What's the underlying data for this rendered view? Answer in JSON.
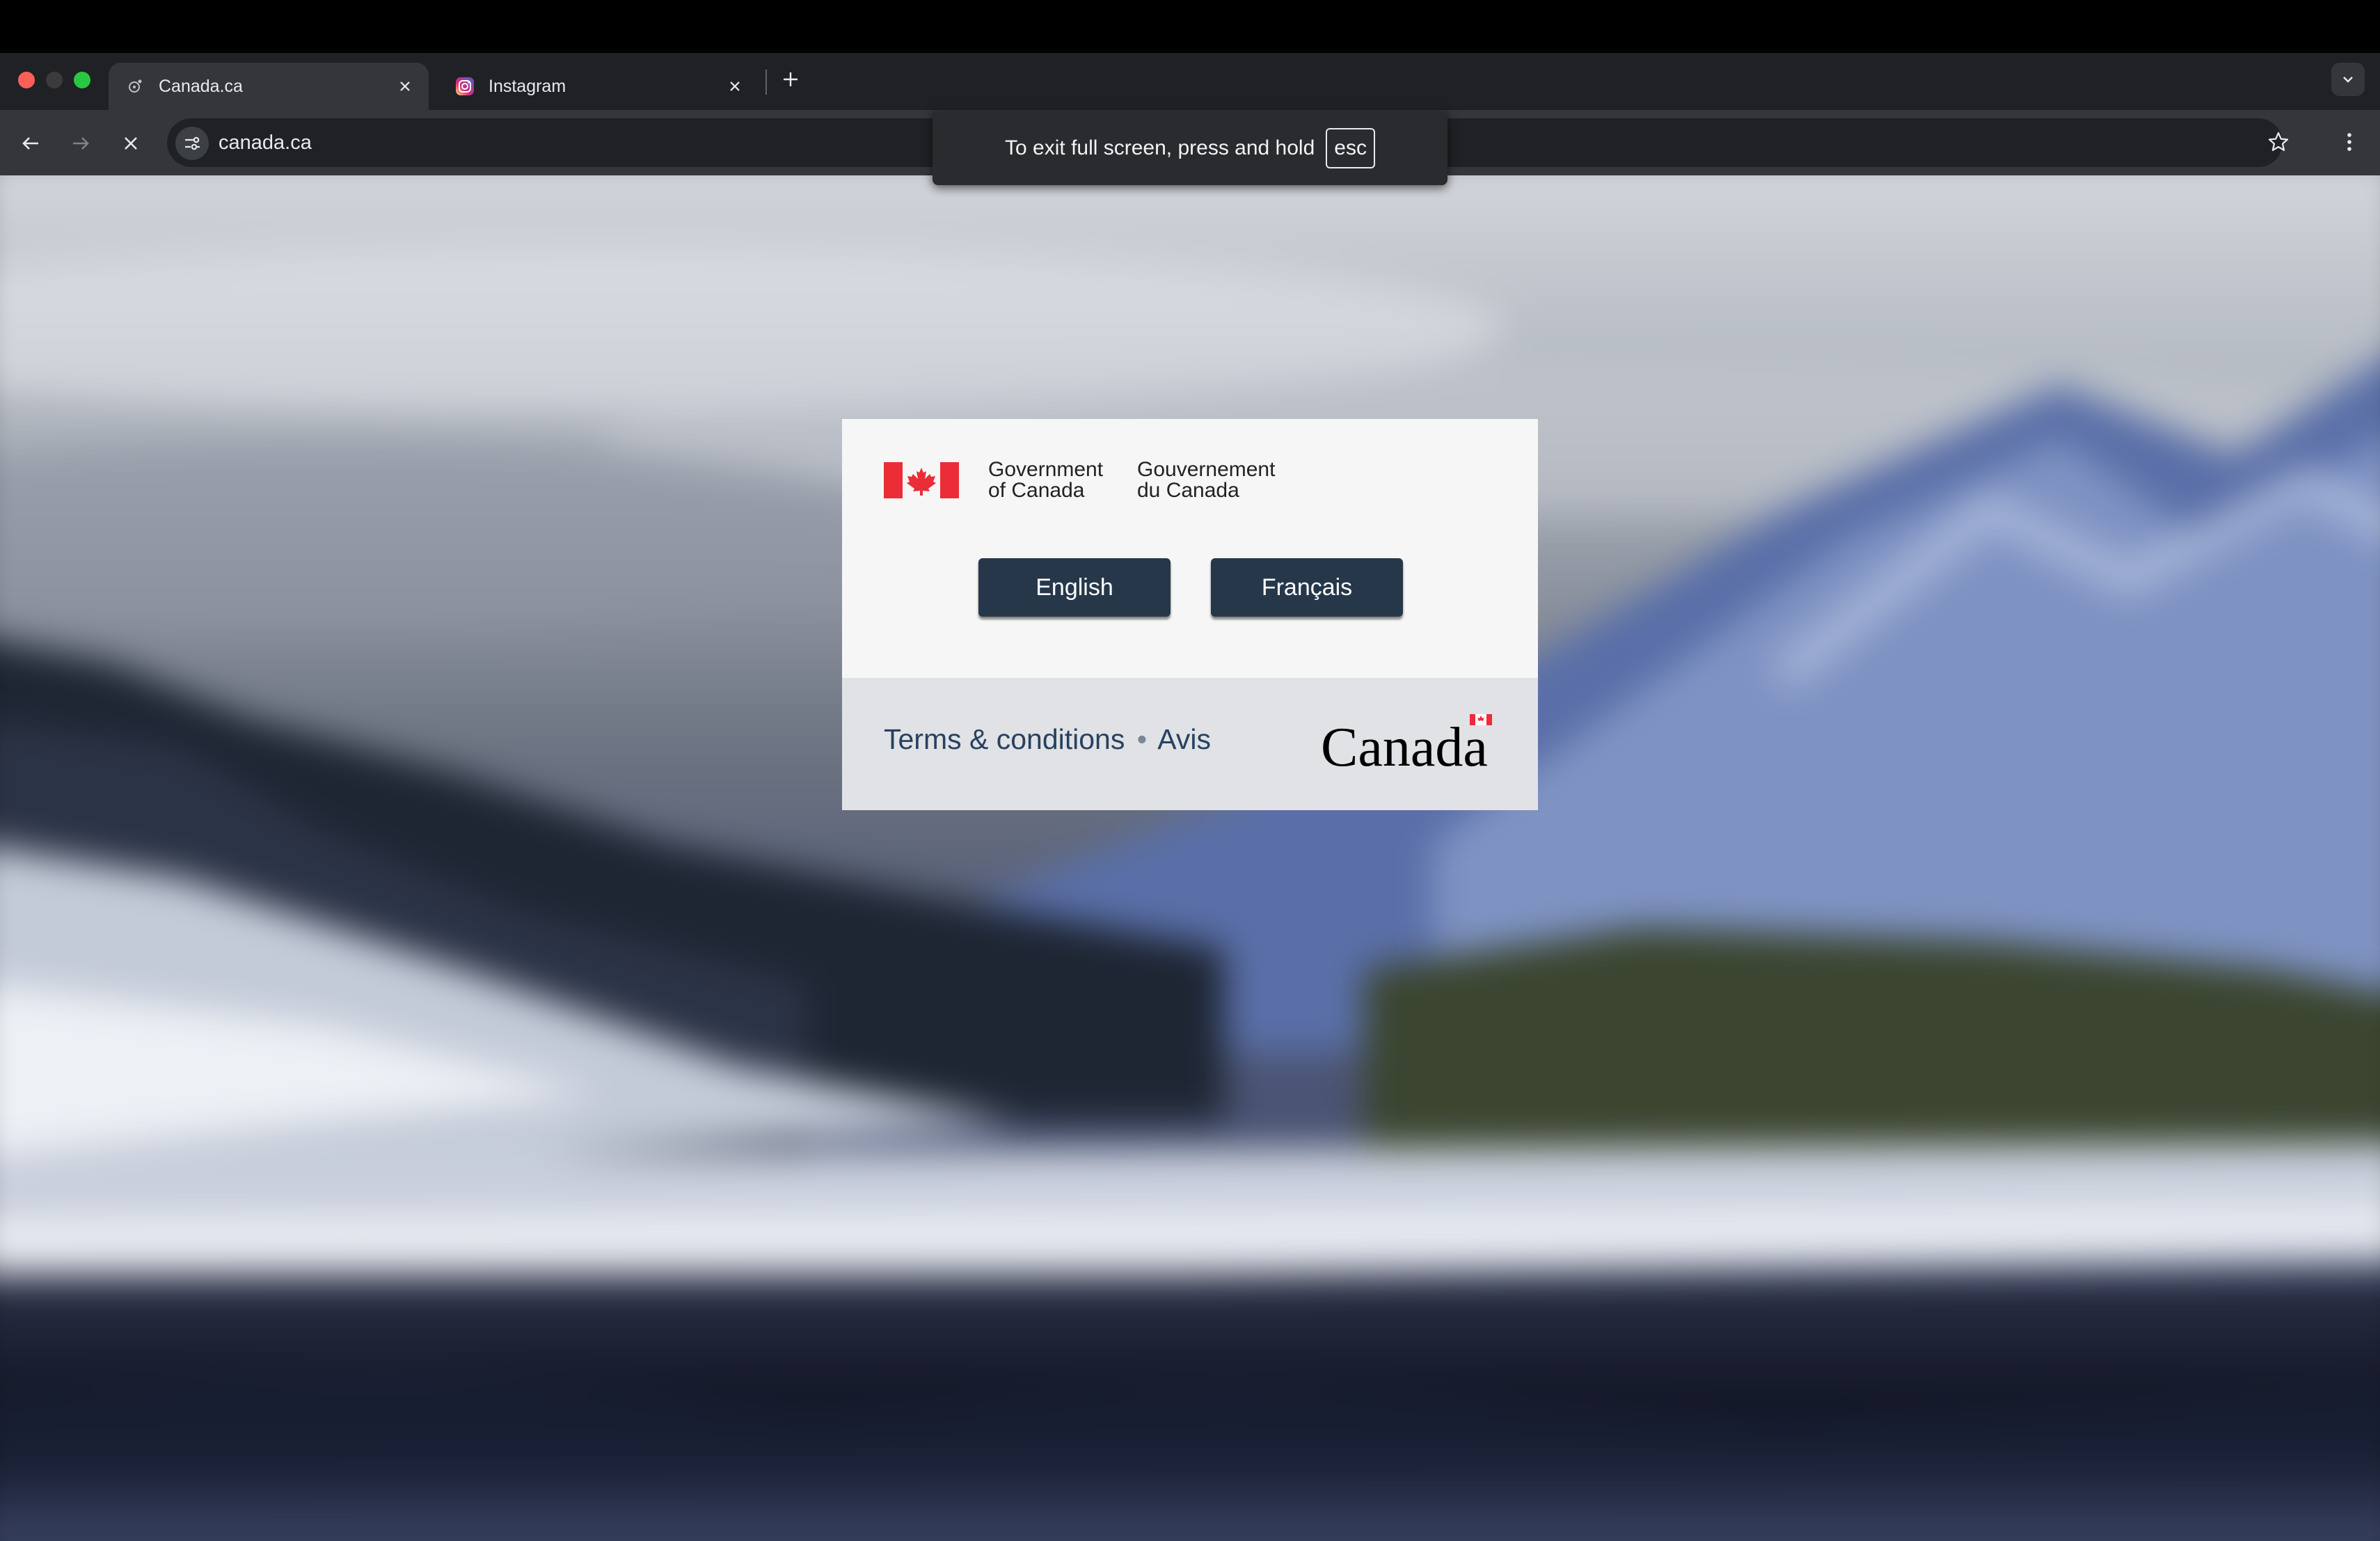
{
  "browser": {
    "tabs": [
      {
        "title": "Canada.ca",
        "favicon": "canada-favicon",
        "active": true
      },
      {
        "title": "Instagram",
        "favicon": "instagram-icon",
        "active": false
      }
    ],
    "url": "canada.ca",
    "fullscreen_notice": {
      "message": "To exit full screen, press and hold",
      "key": "esc"
    }
  },
  "splash": {
    "signature_en": [
      "Government",
      "of Canada"
    ],
    "signature_fr": [
      "Gouvernement",
      "du Canada"
    ],
    "buttons": {
      "english": "English",
      "french": "Français"
    },
    "terms": {
      "en": "Terms & conditions",
      "separator": "•",
      "fr": "Avis"
    },
    "wordmark": "Canada"
  },
  "colors": {
    "button": "#26374a",
    "link": "#284162",
    "flag_red": "#eb2d37",
    "chrome_dark": "#202124",
    "chrome_toolbar": "#35363a"
  }
}
